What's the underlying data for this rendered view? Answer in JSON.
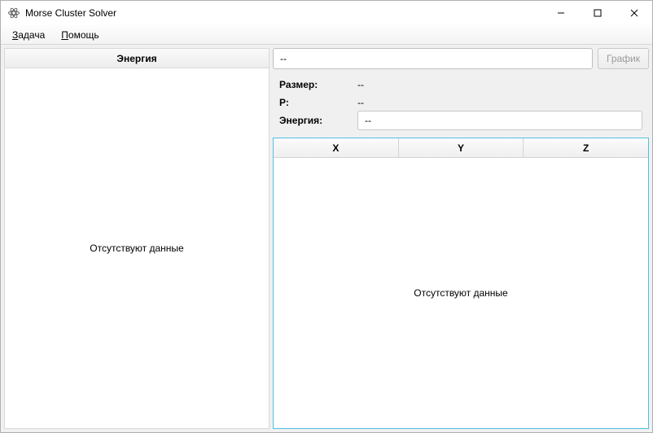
{
  "window": {
    "title": "Morse Cluster Solver"
  },
  "menu": {
    "task": "Задача",
    "help": "Помощь"
  },
  "left": {
    "header": "Энергия",
    "empty": "Отсутствуют данные"
  },
  "right": {
    "main_value": "--",
    "plot_button": "График",
    "labels": {
      "size": "Размер:",
      "p": "Р:",
      "energy": "Энергия:"
    },
    "values": {
      "size": "--",
      "p": "--",
      "energy": "--"
    },
    "columns": {
      "x": "X",
      "y": "Y",
      "z": "Z"
    },
    "empty": "Отсутствуют данные"
  }
}
